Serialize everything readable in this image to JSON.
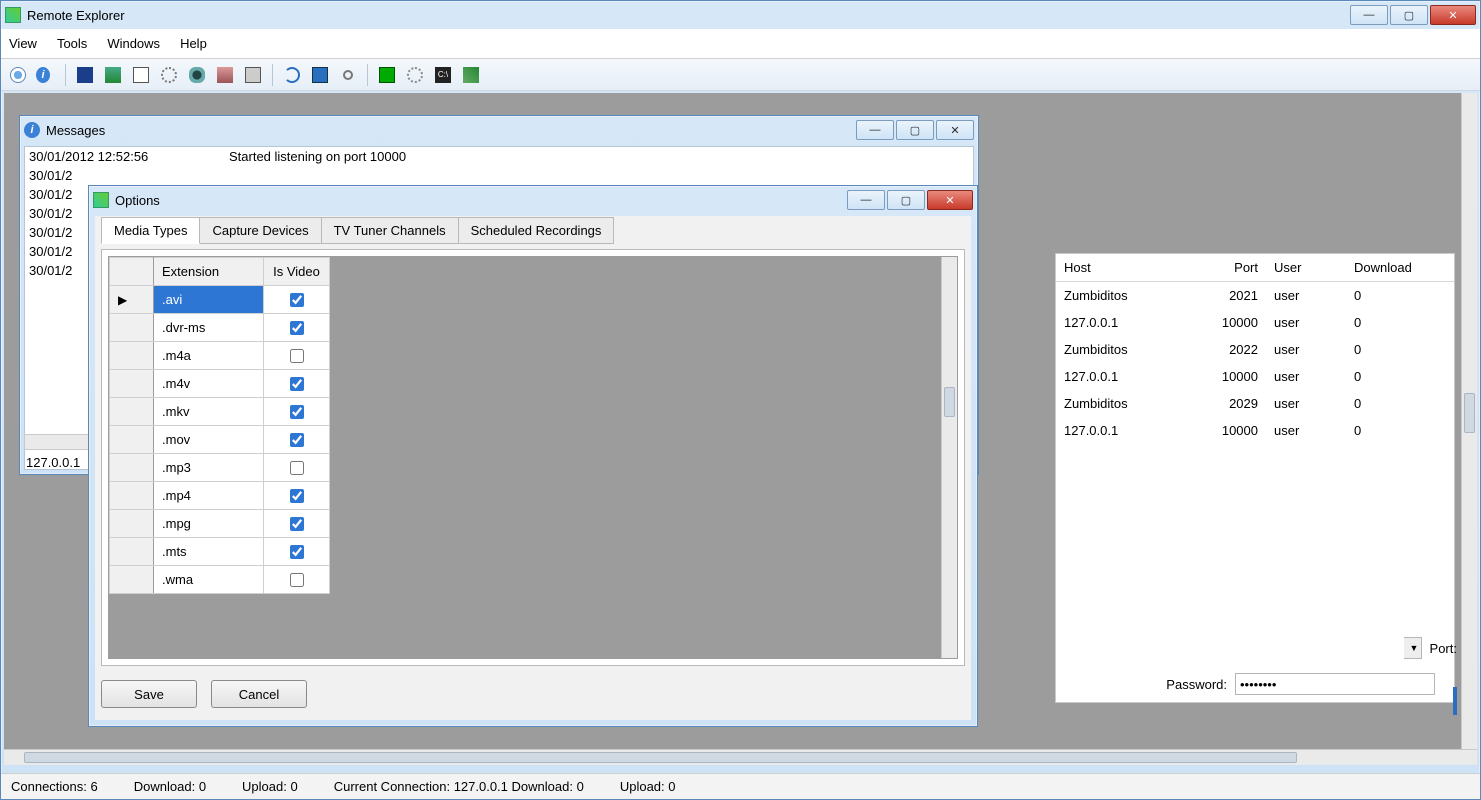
{
  "app": {
    "title": "Remote Explorer"
  },
  "menubar": [
    "View",
    "Tools",
    "Windows",
    "Help"
  ],
  "messages": {
    "title": "Messages",
    "rows": [
      {
        "ts": "30/01/2012 12:52:56",
        "text": "Started listening on port 10000"
      },
      {
        "ts": "30/01/2",
        "text": ""
      },
      {
        "ts": "30/01/2",
        "text": ""
      },
      {
        "ts": "30/01/2",
        "text": ""
      },
      {
        "ts": "30/01/2",
        "text": ""
      },
      {
        "ts": "30/01/2",
        "text": ""
      },
      {
        "ts": "30/01/2",
        "text": ""
      }
    ],
    "footer": "127.0.0.1"
  },
  "options": {
    "title": "Options",
    "tabs": [
      "Media Types",
      "Capture Devices",
      "TV Tuner Channels",
      "Scheduled Recordings"
    ],
    "grid_headers": {
      "extension": "Extension",
      "is_video": "Is Video"
    },
    "media_types": [
      {
        "ext": ".avi",
        "video": true,
        "selected": true
      },
      {
        "ext": ".dvr-ms",
        "video": true
      },
      {
        "ext": ".m4a",
        "video": false
      },
      {
        "ext": ".m4v",
        "video": true
      },
      {
        "ext": ".mkv",
        "video": true
      },
      {
        "ext": ".mov",
        "video": true
      },
      {
        "ext": ".mp3",
        "video": false
      },
      {
        "ext": ".mp4",
        "video": true
      },
      {
        "ext": ".mpg",
        "video": true
      },
      {
        "ext": ".mts",
        "video": true
      },
      {
        "ext": ".wma",
        "video": false
      }
    ],
    "save_label": "Save",
    "cancel_label": "Cancel"
  },
  "hosts": {
    "headers": {
      "host": "Host",
      "port": "Port",
      "user": "User",
      "download": "Download"
    },
    "rows": [
      {
        "host": "Zumbiditos",
        "port": "2021",
        "user": "user",
        "download": "0"
      },
      {
        "host": "127.0.0.1",
        "port": "10000",
        "user": "user",
        "download": "0"
      },
      {
        "host": "Zumbiditos",
        "port": "2022",
        "user": "user",
        "download": "0"
      },
      {
        "host": "127.0.0.1",
        "port": "10000",
        "user": "user",
        "download": "0"
      },
      {
        "host": "Zumbiditos",
        "port": "2029",
        "user": "user",
        "download": "0"
      },
      {
        "host": "127.0.0.1",
        "port": "10000",
        "user": "user",
        "download": "0"
      }
    ],
    "port_label": "Port:",
    "password_label": "Password:",
    "password_value": "********"
  },
  "status": {
    "connections_label": "Connections:",
    "connections_value": "6",
    "download_label": "Download:",
    "download_value": "0",
    "upload_label": "Upload:",
    "upload_value": "0",
    "current_label": "Current Connection:",
    "current_value": "127.0.0.1",
    "cur_dl_label": "Download:",
    "cur_dl_value": "0",
    "cur_ul_label": "Upload:",
    "cur_ul_value": "0"
  }
}
